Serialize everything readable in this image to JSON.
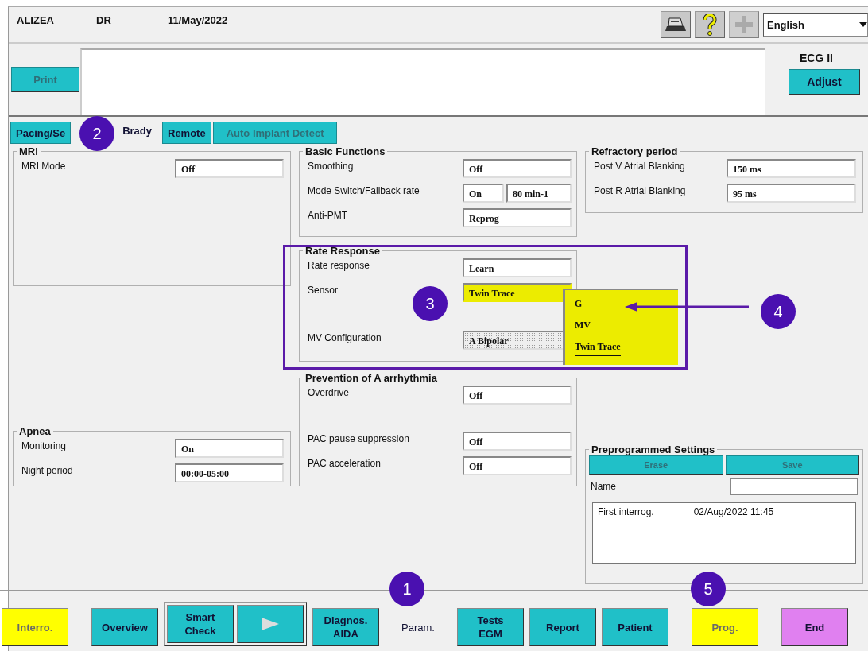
{
  "header": {
    "device": "ALIZEA",
    "mode": "DR",
    "date": "11/May/2022",
    "language": "English"
  },
  "toolbar": [
    {
      "kind": "printer",
      "disabled": false
    },
    {
      "kind": "help",
      "disabled": false
    },
    {
      "kind": "plus",
      "disabled": true
    }
  ],
  "print_button": {
    "label": "Print",
    "disabled": true
  },
  "ecg": {
    "lead": "ECG II",
    "button": "Adjust"
  },
  "tabs": [
    {
      "label": "Pacing/Se",
      "selected": false,
      "disabled": false
    },
    {
      "label": "Brady",
      "selected": true,
      "disabled": false
    },
    {
      "label": "Remote",
      "selected": false,
      "disabled": false
    },
    {
      "label": "Auto Implant Detect",
      "selected": false,
      "disabled": true
    }
  ],
  "columns": [
    {
      "panels": [
        {
          "title": "MRI",
          "rows": [
            {
              "label": "MRI Mode",
              "values": [
                {
                  "text": "Off",
                  "kind": "plain"
                }
              ]
            }
          ]
        },
        {
          "title": "Apnea",
          "rows": [
            {
              "label": "Monitoring",
              "values": [
                {
                  "text": "On",
                  "kind": "plain"
                }
              ]
            },
            {
              "label": "Night period",
              "values": [
                {
                  "text": "00:00-05:00",
                  "kind": "plain"
                }
              ]
            }
          ]
        }
      ]
    },
    {
      "panels": [
        {
          "title": "Basic Functions",
          "rows": [
            {
              "label": "Smoothing",
              "values": [
                {
                  "text": "Off",
                  "kind": "plain"
                }
              ]
            },
            {
              "label": "Mode Switch/Fallback rate",
              "values": [
                {
                  "text": "On",
                  "kind": "plain"
                },
                {
                  "text": "80 min-1",
                  "kind": "plain"
                }
              ]
            },
            {
              "label": "Anti-PMT",
              "values": [
                {
                  "text": "Reprog",
                  "kind": "plain"
                }
              ]
            }
          ]
        },
        {
          "title": "Rate Response",
          "rows": [
            {
              "label": "Rate response",
              "values": [
                {
                  "text": "Learn",
                  "kind": "plain"
                }
              ]
            },
            {
              "label": "Sensor",
              "values": [
                {
                  "text": "Twin Trace",
                  "kind": "highlight"
                }
              ]
            },
            {
              "label": "MV Configuration",
              "values": [
                {
                  "text": "A Bipolar",
                  "kind": "dotted"
                }
              ]
            }
          ]
        },
        {
          "title": "Prevention of A arrhythmia",
          "rows": [
            {
              "label": "Overdrive",
              "values": [
                {
                  "text": "Off",
                  "kind": "plain"
                }
              ]
            },
            {
              "label": "PAC pause suppression",
              "values": [
                {
                  "text": "Off",
                  "kind": "plain"
                }
              ]
            },
            {
              "label": "PAC acceleration",
              "values": [
                {
                  "text": "Off",
                  "kind": "plain"
                }
              ]
            }
          ]
        }
      ]
    },
    {
      "panels": [
        {
          "title": "Refractory period",
          "rows": [
            {
              "label": "Post V Atrial Blanking",
              "values": [
                {
                  "text": "150 ms",
                  "kind": "plain"
                }
              ]
            },
            {
              "label": "Post R Atrial Blanking",
              "values": [
                {
                  "text": "95 ms",
                  "kind": "plain"
                }
              ]
            }
          ]
        }
      ]
    }
  ],
  "preprogrammed": {
    "title": "Preprogrammed Settings",
    "buttons": [
      {
        "label": "Erase",
        "disabled": true
      },
      {
        "label": "Save",
        "disabled": true
      }
    ],
    "name_label": "Name",
    "entries": [
      {
        "name": "First interrog.",
        "date": "02/Aug/2022 11:45"
      }
    ]
  },
  "sensor_dropdown": {
    "options": [
      {
        "label": "G",
        "selected": false
      },
      {
        "label": "MV",
        "selected": false
      },
      {
        "label": "Twin Trace",
        "selected": true
      }
    ]
  },
  "bottom_bar": [
    {
      "kind": "button",
      "label": "Interro.",
      "color": "#ffff00",
      "selected": false,
      "disabled": true
    },
    {
      "kind": "button",
      "label": "Overview",
      "color": "#20c0c8",
      "selected": false,
      "disabled": false
    },
    {
      "kind": "group",
      "items": [
        {
          "kind": "button",
          "label": "Smart\nCheck",
          "color": "#20c0c8",
          "selected": false,
          "disabled": false
        },
        {
          "kind": "play",
          "color": "#20c0c8",
          "selected": false,
          "disabled": false
        }
      ]
    },
    {
      "kind": "button",
      "label": "Diagnos.\nAIDA",
      "color": "#20c0c8",
      "selected": false,
      "disabled": false
    },
    {
      "kind": "button",
      "label": "Param.",
      "color": "#f0f0f0",
      "selected": true,
      "disabled": false
    },
    {
      "kind": "button",
      "label": "Tests\nEGM",
      "color": "#20c0c8",
      "selected": false,
      "disabled": false
    },
    {
      "kind": "button",
      "label": "Report",
      "color": "#20c0c8",
      "selected": false,
      "disabled": false
    },
    {
      "kind": "button",
      "label": "Patient",
      "color": "#20c0c8",
      "selected": false,
      "disabled": false
    },
    {
      "kind": "button",
      "label": "Prog.",
      "color": "#ffff00",
      "selected": false,
      "disabled": true
    },
    {
      "kind": "button",
      "label": "End",
      "color": "#e080f0",
      "selected": false,
      "disabled": false
    }
  ],
  "callouts": [
    "1",
    "2",
    "3",
    "4",
    "5"
  ]
}
